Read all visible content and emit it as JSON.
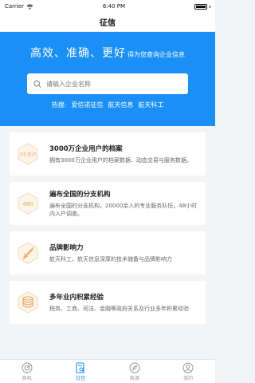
{
  "status_bar": {
    "carrier": "Carrier",
    "time": "6:40 PM"
  },
  "nav": {
    "title": "征信"
  },
  "hero": {
    "slogan_main": "高效、准确、更好",
    "slogan_sub": "得为您查询企业信息",
    "search_placeholder": "请输入企业名称",
    "hot_label": "热搜:",
    "hot_items": [
      "爱信诺征信",
      "航天信息",
      "航天科工"
    ]
  },
  "cards": [
    {
      "title": "3000万企业用户的档案",
      "desc": "拥有3000万企业用户的档案数据、动态交易与服务数据。",
      "icon": "archive-icon",
      "icon_text": "3千万户"
    },
    {
      "title": "遍布全国的分支机构",
      "desc": "遍布全国的分支机构，20000余人的专业服务队伍，48小时内入户调查。",
      "icon": "clock-48h-icon",
      "icon_text": "48h"
    },
    {
      "title": "品牌影响力",
      "desc": "航天科工、航天信息深厚的技术储备与品牌影响力",
      "icon": "rocket-icon",
      "icon_text": ""
    },
    {
      "title": "多年业内积累经验",
      "desc": "税务、工商、司法、金融等政府关系及行业多年积累经验",
      "icon": "database-icon",
      "icon_text": ""
    }
  ],
  "tabs": [
    {
      "label": "商机",
      "icon": "target-icon",
      "active": false
    },
    {
      "label": "征信",
      "icon": "document-search-icon",
      "active": true
    },
    {
      "label": "商调",
      "icon": "compass-icon",
      "active": false
    },
    {
      "label": "我的",
      "icon": "profile-icon",
      "active": false
    }
  ],
  "colors": {
    "primary": "#1a8ff5",
    "card_icon": "#e8a95c"
  }
}
